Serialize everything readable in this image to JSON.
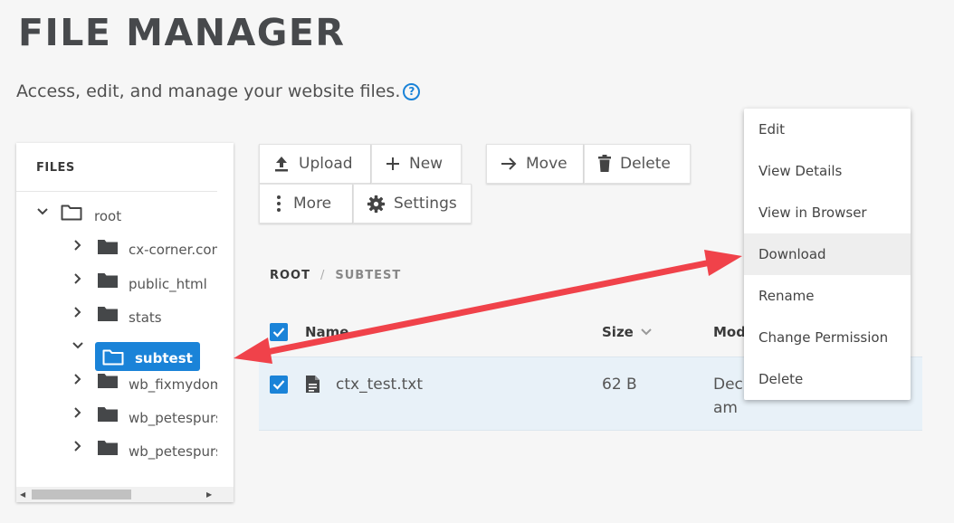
{
  "page": {
    "title": "FILE MANAGER",
    "subtitle": "Access, edit, and manage your website files.",
    "help_icon": "?"
  },
  "colors": {
    "accent": "#1a83d8",
    "annotation_arrow": "#f0424a"
  },
  "tree": {
    "header": "FILES",
    "items": [
      {
        "label": "root",
        "icon": "folder-outline-icon",
        "expanded": true
      },
      {
        "label": "cx-corner.com",
        "icon": "folder-icon",
        "expanded": false
      },
      {
        "label": "public_html",
        "icon": "folder-icon",
        "expanded": false
      },
      {
        "label": "stats",
        "icon": "folder-icon",
        "expanded": false
      },
      {
        "label": "subtest",
        "icon": "folder-outline-icon",
        "expanded": true,
        "selected": true
      },
      {
        "label": "wb_fixmydomain",
        "icon": "folder-icon",
        "expanded": false
      },
      {
        "label": "wb_petespursuits",
        "icon": "folder-icon",
        "expanded": false
      },
      {
        "label": "wb_petespursuits",
        "icon": "folder-icon",
        "expanded": false
      }
    ]
  },
  "toolbar": {
    "upload": "Upload",
    "new": "New",
    "move": "Move",
    "delete": "Delete",
    "more": "More",
    "settings": "Settings"
  },
  "breadcrumb": {
    "root": "ROOT",
    "separator": "/",
    "current": "SUBTEST"
  },
  "table": {
    "columns": {
      "name": "Name",
      "size": "Size",
      "modified": "Mod"
    },
    "rows": [
      {
        "name": "ctx_test.txt",
        "size": "62 B",
        "modified_line1": "Dec",
        "modified_line2": "am",
        "checked": true
      }
    ],
    "header_checked": true
  },
  "context_menu": {
    "items": [
      "Edit",
      "View Details",
      "View in Browser",
      "Download",
      "Rename",
      "Change Permission",
      "Delete"
    ],
    "highlighted": "Download"
  }
}
